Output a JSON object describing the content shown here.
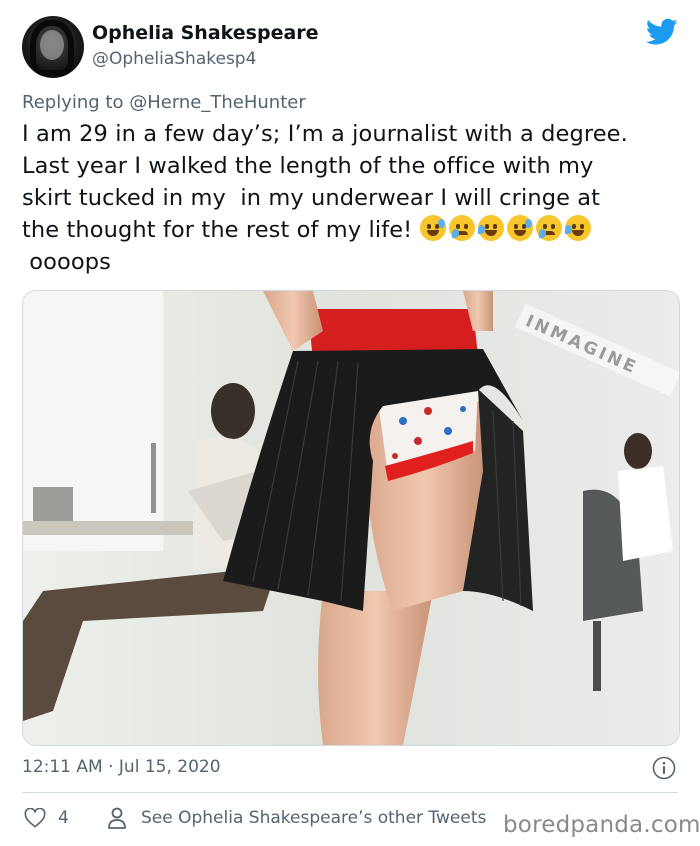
{
  "tweet": {
    "author_name": "Ophelia Shakespeare",
    "author_handle": "@OpheliaShakesp4",
    "reply_prefix": "Replying to ",
    "reply_mention": "@Herne_TheHunter",
    "text_lines": [
      "I am 29 in a few day’s; I’m a journalist with a degree.",
      "Last year I walked the length of the office with my",
      "skirt tucked in my  in my underwear I will cringe at",
      "the thought for the rest of my life! "
    ],
    "text_last": " oooops",
    "emojis": [
      "sweat-smile",
      "crying",
      "joy",
      "sweat-smile",
      "crying",
      "joy"
    ],
    "timestamp": "12:11 AM · Jul 15, 2020",
    "like_count": "4",
    "see_other": "See Ophelia Shakespeare’s other Tweets",
    "image_watermark": "INMAGINE"
  },
  "footer": {
    "site_watermark": "boredpanda.com"
  },
  "colors": {
    "twitter_blue": "#1d9bf0",
    "secondary_text": "#536471",
    "border": "#cfd9de"
  }
}
